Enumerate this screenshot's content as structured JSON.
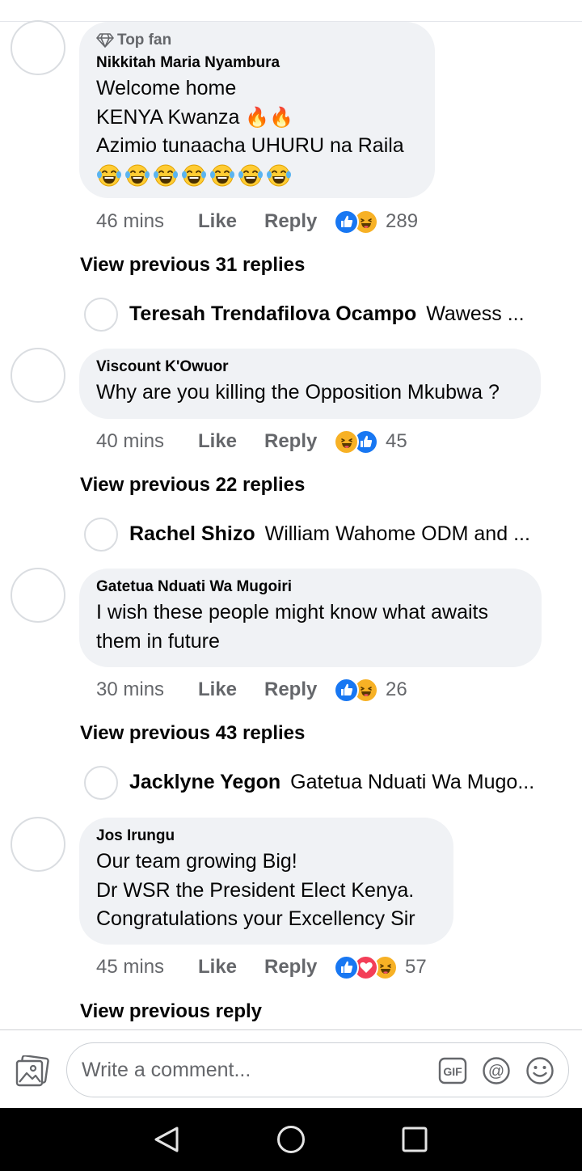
{
  "comments": [
    {
      "badge": "Top fan",
      "author": "Nikkitah Maria Nyambura",
      "text": "Welcome home\nKENYA Kwanza",
      "text_line3": "Azimio tunaacha UHURU na Raila",
      "fire_emoji": "🔥🔥",
      "laugh_emoji_count": 7,
      "time": "46 mins",
      "like_label": "Like",
      "reply_label": "Reply",
      "reactions": [
        "like",
        "haha"
      ],
      "reaction_count": "289",
      "view_previous": "View previous 31 replies",
      "reply_author": "Teresah Trendafilova Ocampo",
      "reply_snippet": "Wawess ..."
    },
    {
      "author": "Viscount K'Owuor",
      "text": "Why are you killing the Opposition Mkubwa ?",
      "time": "40 mins",
      "like_label": "Like",
      "reply_label": "Reply",
      "reactions": [
        "haha",
        "like"
      ],
      "reaction_count": "45",
      "view_previous": "View previous 22 replies",
      "reply_author": "Rachel Shizo",
      "reply_snippet": "William Wahome ODM and ..."
    },
    {
      "author": "Gatetua Nduati Wa Mugoiri",
      "text": "I wish these people might know  what awaits\nthem in future",
      "time": "30 mins",
      "like_label": "Like",
      "reply_label": "Reply",
      "reactions": [
        "like",
        "haha"
      ],
      "reaction_count": "26",
      "view_previous": "View previous 43 replies",
      "reply_author": "Jacklyne Yegon",
      "reply_snippet": "Gatetua Nduati Wa Mugo..."
    },
    {
      "author": "Jos Irungu",
      "text": "Our team growing Big!\nDr WSR the President Elect Kenya.\nCongratulations your Excellency Sir",
      "time": "45 mins",
      "like_label": "Like",
      "reply_label": "Reply",
      "reactions": [
        "like",
        "love",
        "haha"
      ],
      "reaction_count": "57",
      "view_previous": "View previous reply"
    }
  ],
  "composer": {
    "placeholder": "Write a comment...",
    "icons": [
      "photo-icon",
      "gif-icon",
      "mention-icon",
      "emoji-icon"
    ]
  },
  "navbar": {
    "icons": [
      "back-icon",
      "home-icon",
      "recent-apps-icon"
    ]
  },
  "colors": {
    "bubble": "#f0f2f5",
    "like_blue": "#1877f2",
    "love_red": "#f33e58",
    "haha_yellow": "#f7b125",
    "meta_gray": "#65676b"
  }
}
